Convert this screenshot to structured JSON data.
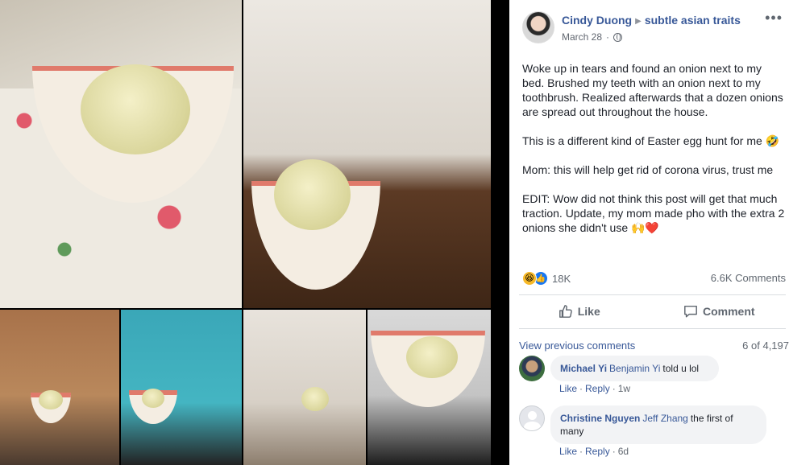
{
  "post": {
    "author": "Cindy Duong",
    "group": "subtle asian traits",
    "date": "March 28",
    "paragraphs": [
      "Woke up in tears and found an onion next to my bed. Brushed my teeth with an onion next to my toothbrush. Realized afterwards that a dozen onions are spread out throughout the house.",
      "This is a different kind of Easter egg hunt for me 🤣",
      "Mom: this will help get rid of corona virus, trust me",
      "EDIT: Wow did not think this post will get that much traction. Update, my mom made pho with the extra 2 onions she didn't use 🙌❤️"
    ],
    "reaction_count": "18K",
    "comment_count": "6.6K Comments",
    "reaction_icons": [
      "haha-icon",
      "like-icon"
    ]
  },
  "actions": {
    "like_label": "Like",
    "comment_label": "Comment"
  },
  "comments_section": {
    "view_previous": "View previous comments",
    "counter": "6 of 4,197",
    "items": [
      {
        "name": "Michael Yi",
        "tag": "Benjamin Yi",
        "text": "told u lol",
        "like": "Like",
        "reply": "Reply",
        "age": "1w"
      },
      {
        "name": "Christine Nguyen",
        "tag": "Jeff Zhang",
        "text": "the first of many",
        "like": "Like",
        "reply": "Reply",
        "age": "6d"
      }
    ]
  },
  "colors": {
    "link": "#385898",
    "secondary_text": "#606770",
    "bubble_bg": "#f2f3f5",
    "like_blue": "#1877f2",
    "haha_yellow": "#f7b928"
  }
}
